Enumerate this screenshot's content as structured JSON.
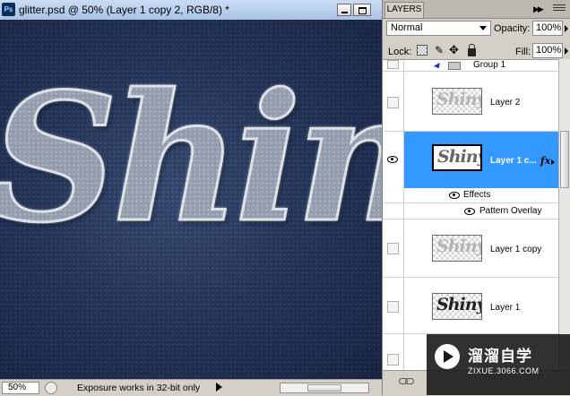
{
  "document": {
    "app_icon_label": "Ps",
    "title": "glitter.psd @ 50% (Layer 1 copy 2, RGB/8) *",
    "canvas_text": "Shiny",
    "zoom": "50%",
    "status_text": "Exposure works in 32-bit only"
  },
  "layers_panel": {
    "tab_label": "LAYERS",
    "blend_mode": "Normal",
    "opacity_label": "Opacity:",
    "opacity_value": "100%",
    "lock_label": "Lock:",
    "fill_label": "Fill:",
    "fill_value": "100%",
    "layers": [
      {
        "name": "Group 1",
        "type": "group"
      },
      {
        "name": "Layer 2",
        "thumb_text": "Shiny"
      },
      {
        "name": "Layer 1 c...",
        "thumb_text": "Shiny",
        "selected": true,
        "visible": true,
        "fx": "fx"
      },
      {
        "name": "Layer 1 copy",
        "thumb_text": "Shiny"
      },
      {
        "name": "Layer 1",
        "thumb_text": "Shiny"
      }
    ],
    "effects_label": "Effects",
    "pattern_overlay_label": "Pattern Overlay"
  },
  "watermark": {
    "title": "溜溜自学",
    "subtitle": "ZIXUE.3066.COM"
  },
  "colors": {
    "selection": "#3399ff",
    "canvas_bg": "#253556"
  }
}
